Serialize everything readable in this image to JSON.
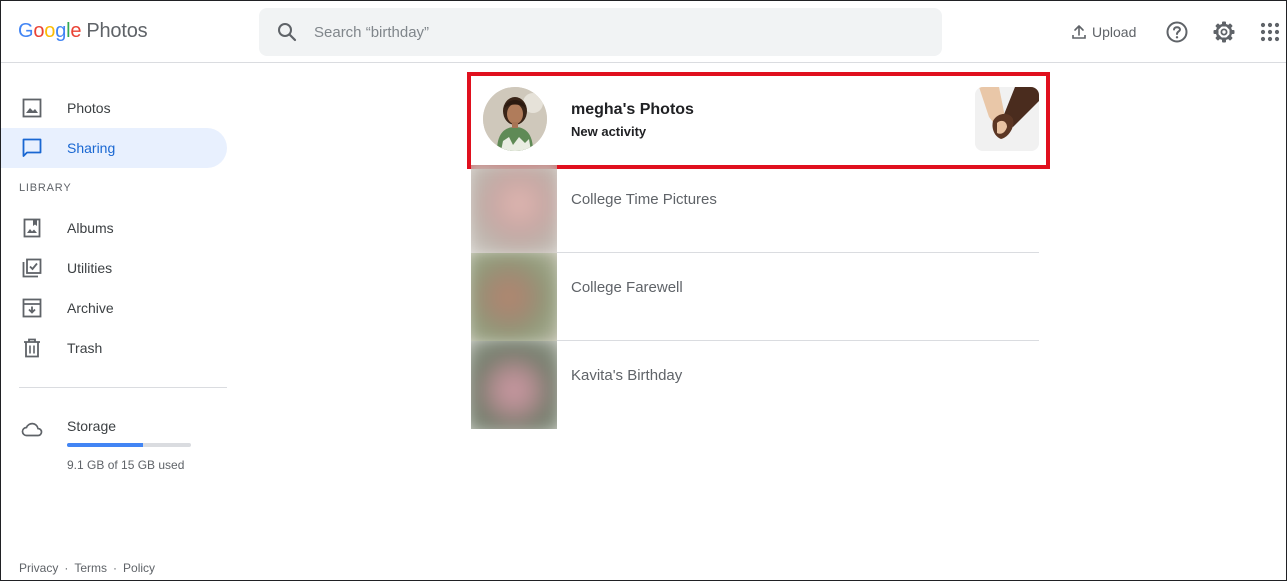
{
  "header": {
    "logo_letters": [
      "G",
      "o",
      "o",
      "g",
      "l",
      "e"
    ],
    "logo_product": "Photos",
    "search_placeholder": "Search “birthday”",
    "upload_label": "Upload"
  },
  "sidebar": {
    "items": [
      {
        "label": "Photos",
        "icon": "image-icon"
      },
      {
        "label": "Sharing",
        "icon": "chat-bubble-icon",
        "active": true
      }
    ],
    "library_label": "LIBRARY",
    "library_items": [
      {
        "label": "Albums",
        "icon": "album-icon"
      },
      {
        "label": "Utilities",
        "icon": "utilities-icon"
      },
      {
        "label": "Archive",
        "icon": "archive-icon"
      },
      {
        "label": "Trash",
        "icon": "trash-icon"
      }
    ],
    "storage": {
      "label": "Storage",
      "usage_text": "9.1 GB of 15 GB used",
      "used_fraction": 0.61
    }
  },
  "footer": {
    "links": [
      "Privacy",
      "Terms",
      "Policy"
    ],
    "separator": "·"
  },
  "shares": {
    "first": {
      "title": "megha's Photos",
      "subtitle": "New activity"
    },
    "items": [
      {
        "label": "College Time Pictures"
      },
      {
        "label": "College Farewell"
      },
      {
        "label": "Kavita's Birthday"
      }
    ]
  },
  "colors": {
    "accent": "#1967d2",
    "active_bg": "#e8f0fe",
    "highlight_border": "#e0101e",
    "storage_fill": "#4285f4"
  }
}
